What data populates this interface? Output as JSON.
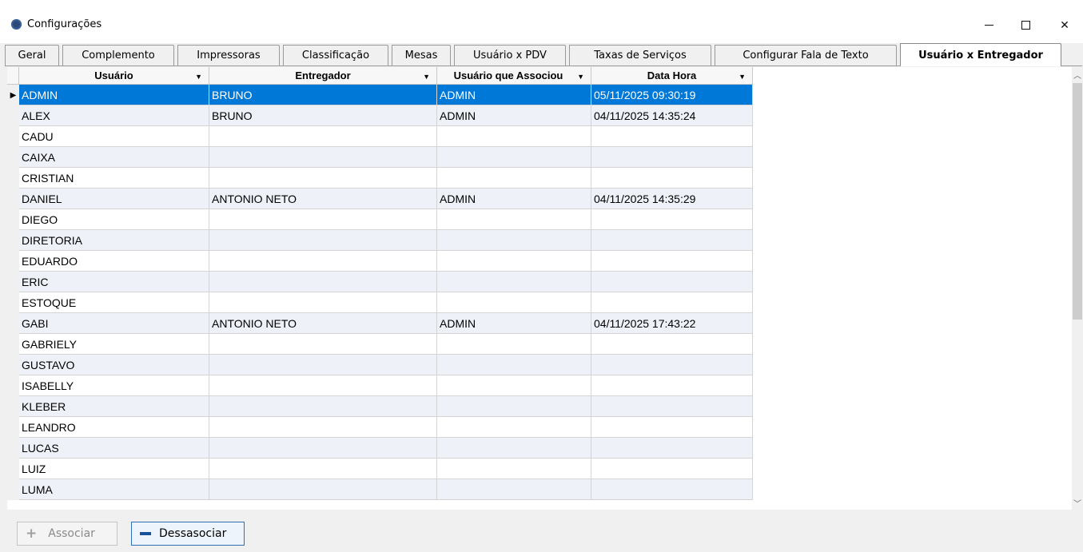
{
  "window": {
    "title": "Configurações"
  },
  "tabs": [
    {
      "label": "Geral"
    },
    {
      "label": "Complemento"
    },
    {
      "label": "Impressoras"
    },
    {
      "label": "Classificação"
    },
    {
      "label": "Mesas"
    },
    {
      "label": "Usuário x PDV"
    },
    {
      "label": "Taxas de Serviços"
    },
    {
      "label": "Configurar Fala de Texto"
    },
    {
      "label": "Usuário x Entregador"
    }
  ],
  "active_tab": "Usuário x Entregador",
  "grid": {
    "columns": [
      "Usuário",
      "Entregador",
      "Usuário que Associou",
      "Data Hora"
    ],
    "rows": [
      {
        "usuario": "ADMIN",
        "entregador": "BRUNO",
        "associou": "ADMIN",
        "data": "05/11/2025 09:30:19"
      },
      {
        "usuario": "ALEX",
        "entregador": "BRUNO",
        "associou": "ADMIN",
        "data": "04/11/2025 14:35:24"
      },
      {
        "usuario": "CADU",
        "entregador": "",
        "associou": "",
        "data": ""
      },
      {
        "usuario": "CAIXA",
        "entregador": "",
        "associou": "",
        "data": ""
      },
      {
        "usuario": "CRISTIAN",
        "entregador": "",
        "associou": "",
        "data": ""
      },
      {
        "usuario": "DANIEL",
        "entregador": "ANTONIO NETO",
        "associou": "ADMIN",
        "data": "04/11/2025 14:35:29"
      },
      {
        "usuario": "DIEGO",
        "entregador": "",
        "associou": "",
        "data": ""
      },
      {
        "usuario": "DIRETORIA",
        "entregador": "",
        "associou": "",
        "data": ""
      },
      {
        "usuario": "EDUARDO",
        "entregador": "",
        "associou": "",
        "data": ""
      },
      {
        "usuario": "ERIC",
        "entregador": "",
        "associou": "",
        "data": ""
      },
      {
        "usuario": "ESTOQUE",
        "entregador": "",
        "associou": "",
        "data": ""
      },
      {
        "usuario": "GABI",
        "entregador": "ANTONIO NETO",
        "associou": "ADMIN",
        "data": "04/11/2025 17:43:22"
      },
      {
        "usuario": "GABRIELY",
        "entregador": "",
        "associou": "",
        "data": ""
      },
      {
        "usuario": "GUSTAVO",
        "entregador": "",
        "associou": "",
        "data": ""
      },
      {
        "usuario": "ISABELLY",
        "entregador": "",
        "associou": "",
        "data": ""
      },
      {
        "usuario": "KLEBER",
        "entregador": "",
        "associou": "",
        "data": ""
      },
      {
        "usuario": "LEANDRO",
        "entregador": "",
        "associou": "",
        "data": ""
      },
      {
        "usuario": "LUCAS",
        "entregador": "",
        "associou": "",
        "data": ""
      },
      {
        "usuario": "LUIZ",
        "entregador": "",
        "associou": "",
        "data": ""
      },
      {
        "usuario": "LUMA",
        "entregador": "",
        "associou": "",
        "data": ""
      }
    ],
    "selected_row": 0
  },
  "buttons": {
    "associar": "Associar",
    "dessasociar": "Dessasociar"
  },
  "colors": {
    "selection": "#0078d7",
    "alt_row": "#eef2f8"
  }
}
